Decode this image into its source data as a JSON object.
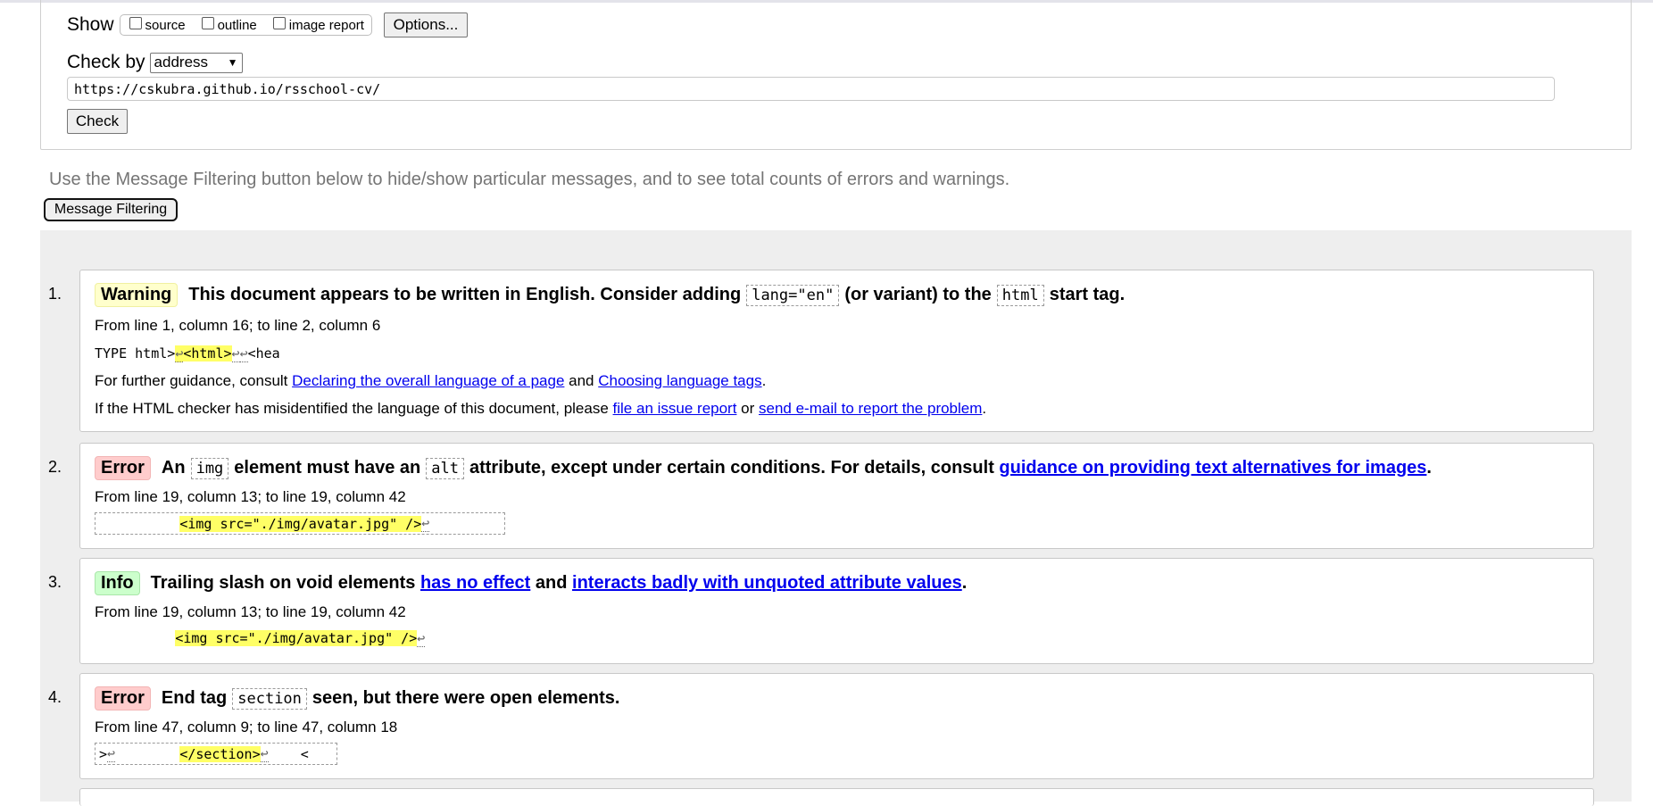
{
  "form": {
    "show_label": "Show",
    "options": [
      {
        "label": "source",
        "checked": false
      },
      {
        "label": "outline",
        "checked": false
      },
      {
        "label": "image report",
        "checked": false
      }
    ],
    "options_button": "Options...",
    "checkby_label": "Check by",
    "checkby_value": "address",
    "url_value": "https://cskubra.github.io/rsschool-cv/",
    "check_button": "Check"
  },
  "hint": "Use the Message Filtering button below to hide/show particular messages, and to see total counts of errors and warnings.",
  "filter_button": "Message Filtering",
  "messages": [
    {
      "number": "1.",
      "type": "Warning",
      "title_a": "This document appears to be written in English. Consider adding",
      "code_a": "lang=\"en\"",
      "title_b": "(or variant) to the",
      "code_b": "html",
      "title_c": "start tag.",
      "location": "From line 1, column 16; to line 2, column 6",
      "extract_pre": "TYPE html>",
      "extract_hl": "<html>",
      "extract_post": "<hea",
      "guidance_pre": "For further guidance, consult ",
      "guidance_link1": "Declaring the overall language of a page",
      "guidance_mid": " and ",
      "guidance_link2": "Choosing language tags",
      "guidance_post": ".",
      "report_pre": "If the HTML checker has misidentified the language of this document, please ",
      "report_link1": "file an issue report",
      "report_mid": " or ",
      "report_link2": "send e-mail to report the problem",
      "report_post": "."
    },
    {
      "number": "2.",
      "type": "Error",
      "title_a": "An",
      "code_a": "img",
      "title_b": "element must have an",
      "code_b": "alt",
      "title_c": "attribute, except under certain conditions. For details, consult",
      "link": "guidance on providing text alternatives for images",
      "title_end": ".",
      "location": "From line 19, column 13; to line 19, column 42",
      "extract_hl": "<img src=\"./img/avatar.jpg\" />"
    },
    {
      "number": "3.",
      "type": "Info",
      "title_a": "Trailing slash on void elements",
      "link1": "has no effect",
      "title_b": "and",
      "link2": "interacts badly with unquoted attribute values",
      "title_end": ".",
      "location": "From line 19, column 13; to line 19, column 42",
      "extract_hl": "<img src=\"./img/avatar.jpg\" />"
    },
    {
      "number": "4.",
      "type": "Error",
      "title_a": "End tag",
      "code_a": "section",
      "title_b": "seen, but there were open elements.",
      "location": "From line 47, column 9; to line 47, column 18",
      "extract_pre": ">",
      "extract_hl": "</section>",
      "extract_post": "<"
    }
  ]
}
